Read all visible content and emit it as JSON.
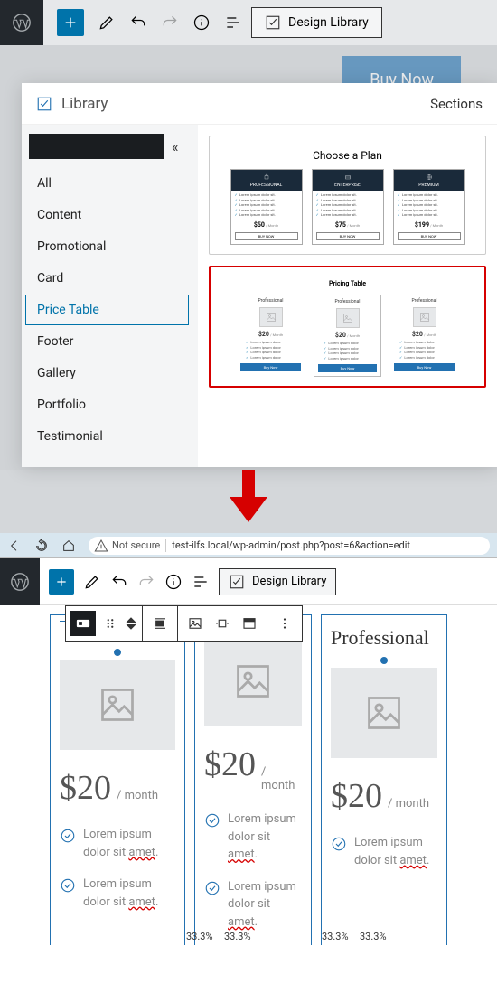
{
  "top": {
    "design_library": "Design Library",
    "buy_now": "Buy Now"
  },
  "library": {
    "title": "Library",
    "tabs": "Sections",
    "categories": [
      "All",
      "Content",
      "Promotional",
      "Card",
      "Price Table",
      "Footer",
      "Gallery",
      "Portfolio",
      "Testimonial"
    ],
    "template1": {
      "title": "Choose a Plan",
      "plans": [
        {
          "name": "PROFESSIONAL",
          "price": "$50",
          "unit": "/ Month",
          "cta": "BUY NOW",
          "features": [
            "Lorem ipsum dolor sit.",
            "Lorem ipsum dolor sit.",
            "Lorem ipsum dolor sit.",
            "Lorem ipsum dolor sit.",
            "Lorem ipsum dolor sit."
          ]
        },
        {
          "name": "ENTERPRISE",
          "price": "$75",
          "unit": "/ Month",
          "cta": "BUY NOW",
          "features": [
            "Lorem ipsum dolor sit.",
            "Lorem ipsum dolor sit.",
            "Lorem ipsum dolor sit.",
            "Lorem ipsum dolor sit.",
            "Lorem ipsum dolor sit."
          ]
        },
        {
          "name": "PREMIUM",
          "price": "$199",
          "unit": "/ Month",
          "cta": "BUY NOW",
          "features": [
            "Lorem ipsum dolor sit.",
            "Lorem ipsum dolor sit.",
            "Lorem ipsum dolor sit.",
            "Lorem ipsum dolor sit.",
            "Lorem ipsum dolor sit."
          ]
        }
      ]
    },
    "template2": {
      "title": "Pricing Table",
      "plans": [
        {
          "name": "Professional",
          "price": "$20",
          "unit": "/ Month",
          "cta": "Buy Now",
          "features": [
            "Lorem ipsum dolor",
            "Lorem ipsum dolor",
            "Lorem ipsum dolor",
            "Lorem ipsum dolor"
          ]
        },
        {
          "name": "Professional",
          "price": "$20",
          "unit": "/ Month",
          "cta": "Buy Now",
          "features": [
            "Lorem ipsum dolor",
            "Lorem ipsum dolor",
            "Lorem ipsum dolor",
            "Lorem ipsum dolor"
          ]
        },
        {
          "name": "Professional",
          "price": "$20",
          "unit": "/ Month",
          "cta": "Buy Now",
          "features": [
            "Lorem ipsum dolor",
            "Lorem ipsum dolor",
            "Lorem ipsum dolor",
            "Lorem ipsum dolor"
          ]
        }
      ]
    }
  },
  "bottom": {
    "not_secure": "Not secure",
    "url": "test-ilfs.local/wp-admin/post.php?post=6&action=edit",
    "design_library": "Design Library",
    "heading_partial": "Professional",
    "columns": [
      {
        "title": "",
        "price": "$20",
        "per": "/ month",
        "features": [
          {
            "text": "Lorem ipsum dolor sit ",
            "u": "amet"
          },
          {
            "text": "Lorem ipsum dolor sit ",
            "u": "amet"
          }
        ]
      },
      {
        "title": "",
        "price": "$20",
        "per": "/ month",
        "features": [
          {
            "text": "Lorem ipsum dolor sit ",
            "u": "amet"
          },
          {
            "text": "Lorem ipsum dolor sit ",
            "u": "amet"
          }
        ]
      },
      {
        "title": "Professional",
        "price": "$20",
        "per": "/ month",
        "features": [
          {
            "text": "Lorem ipsum dolor sit ",
            "u": "amet"
          }
        ]
      }
    ],
    "percent": "33.3%"
  }
}
